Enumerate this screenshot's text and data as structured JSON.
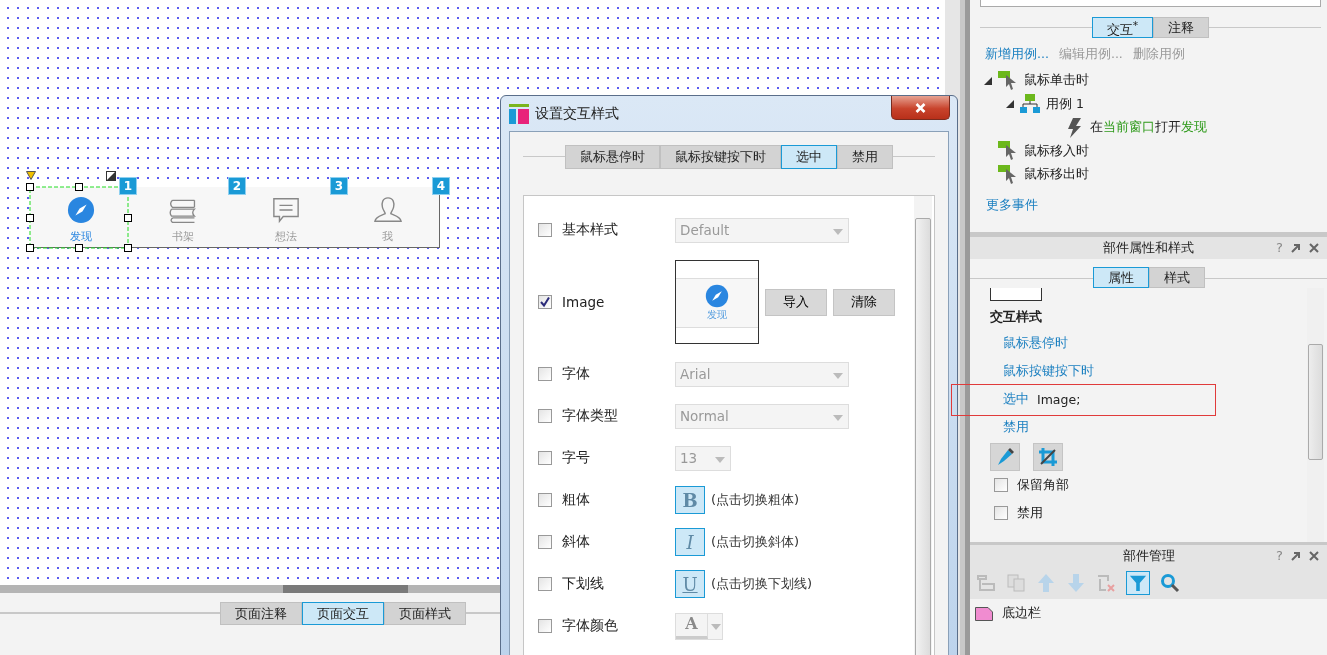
{
  "canvas": {
    "tab_bar": {
      "items": [
        {
          "label": "发现",
          "selected": true,
          "badge": "1"
        },
        {
          "label": "书架",
          "selected": false,
          "badge": "2"
        },
        {
          "label": "想法",
          "selected": false,
          "badge": "3"
        },
        {
          "label": "我",
          "selected": false,
          "badge": "4"
        }
      ]
    }
  },
  "page_tabs": [
    {
      "label": "页面注释",
      "selected": false
    },
    {
      "label": "页面交互",
      "selected": true
    },
    {
      "label": "页面样式",
      "selected": false
    }
  ],
  "dialog": {
    "title": "设置交互样式",
    "tabs": [
      {
        "label": "鼠标悬停时",
        "selected": false
      },
      {
        "label": "鼠标按键按下时",
        "selected": false
      },
      {
        "label": "选中",
        "selected": true
      },
      {
        "label": "禁用",
        "selected": false
      }
    ],
    "rows": [
      {
        "kind": "dropdown",
        "label": "基本样式",
        "checked": false,
        "value": "Default"
      },
      {
        "kind": "image",
        "label": "Image",
        "checked": true,
        "preview_caption": "发现",
        "buttons": [
          "导入",
          "清除"
        ]
      },
      {
        "kind": "dropdown",
        "label": "字体",
        "checked": false,
        "value": "Arial"
      },
      {
        "kind": "dropdown",
        "label": "字体类型",
        "checked": false,
        "value": "Normal"
      },
      {
        "kind": "small-dropdown",
        "label": "字号",
        "checked": false,
        "value": "13"
      },
      {
        "kind": "toggle",
        "label": "粗体",
        "checked": false,
        "glyph": "B",
        "hint": "(点击切换粗体)"
      },
      {
        "kind": "toggle",
        "label": "斜体",
        "checked": false,
        "glyph": "I",
        "hint": "(点击切换斜体)"
      },
      {
        "kind": "toggle",
        "label": "下划线",
        "checked": false,
        "glyph": "U",
        "hint": "(点击切换下划线)"
      },
      {
        "kind": "color",
        "label": "字体颜色",
        "checked": false,
        "glyph": "A"
      }
    ]
  },
  "interactions": {
    "tabs": [
      {
        "label": "交互$^{*}$",
        "selected": true
      },
      {
        "label": "注释",
        "selected": false
      }
    ],
    "actions": [
      {
        "label": "新增用例...",
        "disabled": false
      },
      {
        "label": "编辑用例...",
        "disabled": true
      },
      {
        "label": "删除用例",
        "disabled": true
      }
    ],
    "events": [
      {
        "kind": "event",
        "label": "鼠标单击时",
        "expanded": true,
        "children": [
          {
            "kind": "case",
            "label": "用例 1",
            "expanded": true,
            "children": [
              {
                "kind": "action",
                "parts": [
                  {
                    "text": "在",
                    "highlight": false
                  },
                  {
                    "text": "当前窗口",
                    "highlight": true
                  },
                  {
                    "text": "打开",
                    "highlight": false
                  },
                  {
                    "text": "发现",
                    "highlight": true
                  }
                ]
              }
            ]
          }
        ]
      },
      {
        "kind": "event",
        "label": "鼠标移入时"
      },
      {
        "kind": "event",
        "label": "鼠标移出时"
      }
    ],
    "more_link": "更多事件"
  },
  "properties": {
    "title": "部件属性和样式",
    "help": "?",
    "tabs": [
      {
        "label": "属性",
        "selected": true
      },
      {
        "label": "样式",
        "selected": false
      }
    ],
    "section_title": "交互样式",
    "styles": [
      {
        "label": "鼠标悬停时"
      },
      {
        "label": "鼠标按键按下时"
      },
      {
        "label": "选中",
        "value": "Image;"
      },
      {
        "label": "禁用"
      }
    ],
    "checkboxes": [
      {
        "label": "保留角部",
        "checked": false
      },
      {
        "label": "禁用",
        "checked": false
      }
    ]
  },
  "widget_manager": {
    "title": "部件管理",
    "help": "?",
    "filter_on": true,
    "items": [
      {
        "label": "底边栏"
      }
    ]
  }
}
